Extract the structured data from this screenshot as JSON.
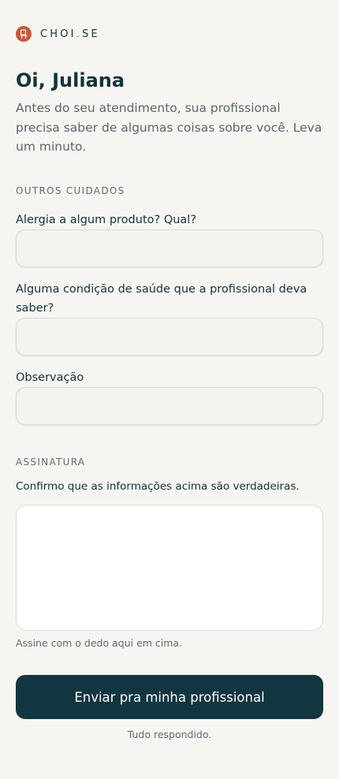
{
  "brand": {
    "name_part1": "CHOI",
    "dot": ".",
    "name_part2": "SE",
    "logo_icon": "chair-icon",
    "accent_color": "#c9573c"
  },
  "header": {
    "greeting": "Oi, Juliana",
    "intro": "Antes do seu atendimento, sua profissional precisa saber de algumas coisas sobre você. Leva um minuto."
  },
  "sections": {
    "care": {
      "title": "OUTROS CUIDADOS",
      "fields": [
        {
          "label": "Alergia a algum produto? Qual?",
          "value": ""
        },
        {
          "label": "Alguma condição de saúde que a profissional deva saber?",
          "value": ""
        },
        {
          "label": "Observação",
          "value": ""
        }
      ]
    },
    "signature": {
      "title": "ASSINATURA",
      "confirm": "Confirmo que as informações acima são verdadeiras.",
      "hint": "Assine com o dedo aqui em cima."
    }
  },
  "actions": {
    "submit_label": "Enviar pra minha profissional",
    "status": "Tudo respondido."
  },
  "colors": {
    "primary": "#12363f",
    "background": "#f6f5f1",
    "muted_text": "#5f6b70"
  }
}
